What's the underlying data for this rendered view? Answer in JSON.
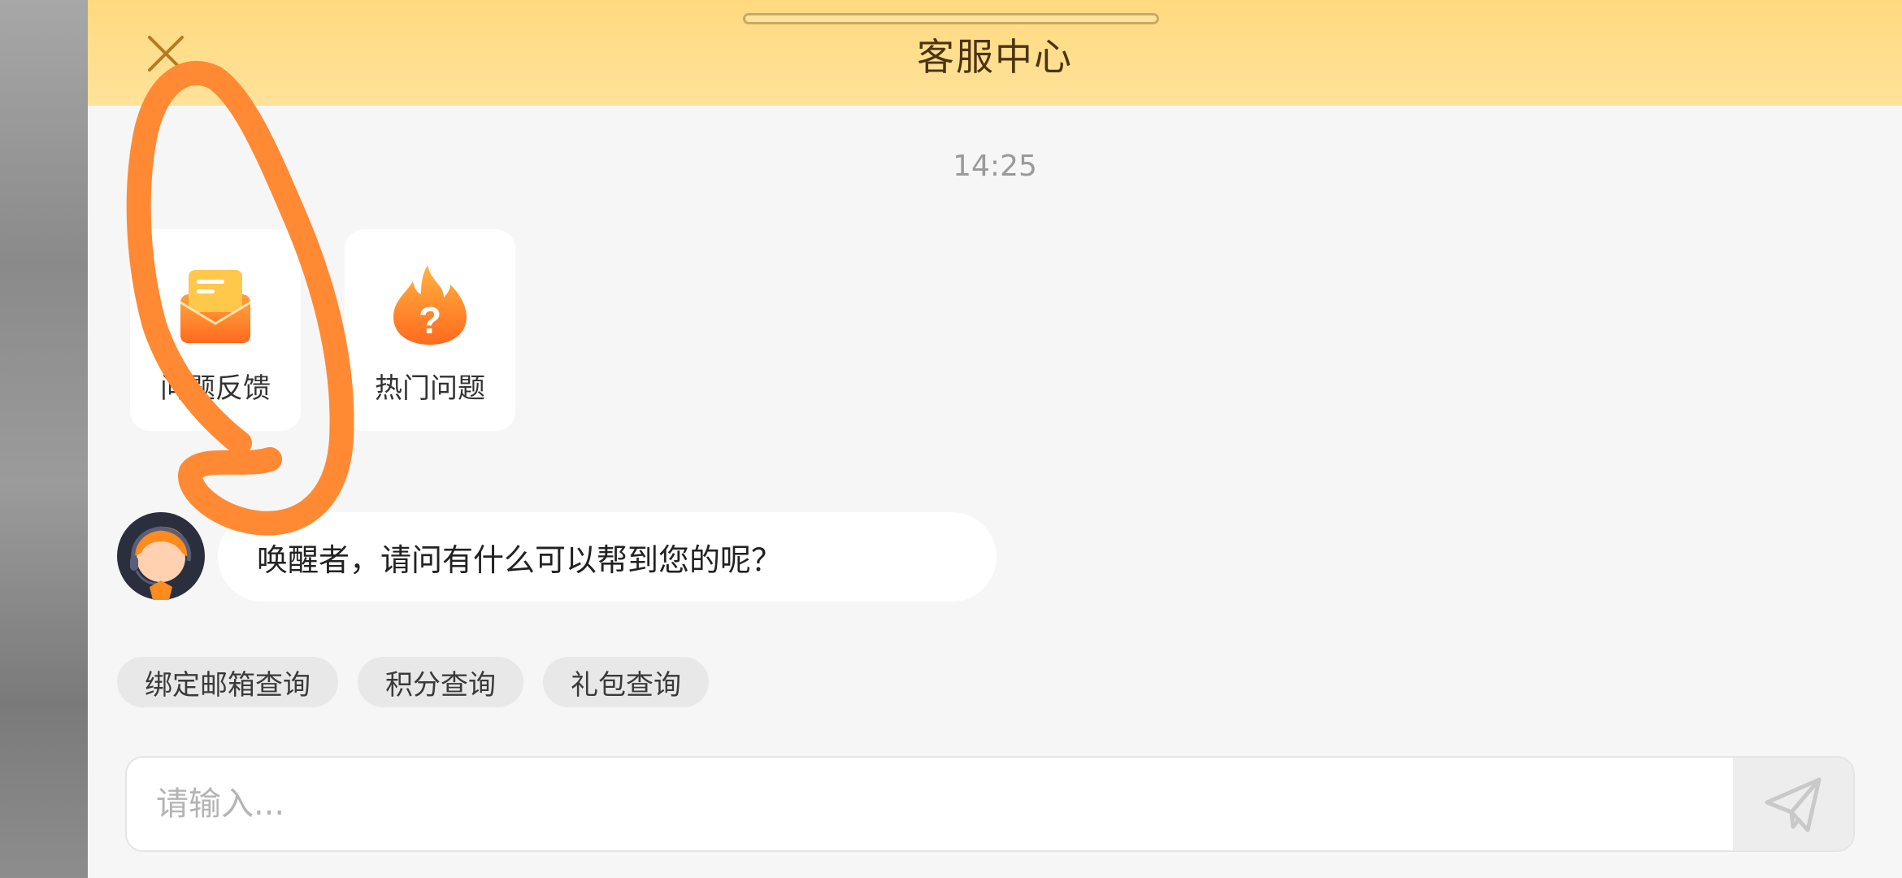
{
  "header": {
    "title": "客服中心"
  },
  "chat": {
    "timestamp": "14:25",
    "quick_actions": [
      {
        "label": "问题反馈",
        "icon": "mail-envelope-icon"
      },
      {
        "label": "热门问题",
        "icon": "fire-question-icon"
      }
    ],
    "agent_message": "唤醒者，请问有什么可以帮到您的呢？",
    "suggestions": [
      "绑定邮箱查询",
      "积分查询",
      "礼包查询"
    ]
  },
  "input": {
    "placeholder": "请输入..."
  },
  "colors": {
    "header_bg": "#ffdf8f",
    "accent_orange": "#ff8a2b",
    "panel_bg": "#f6f6f6",
    "annotation_stroke": "#ff8a33"
  },
  "annotation": "hand-drawn-orange-loop"
}
